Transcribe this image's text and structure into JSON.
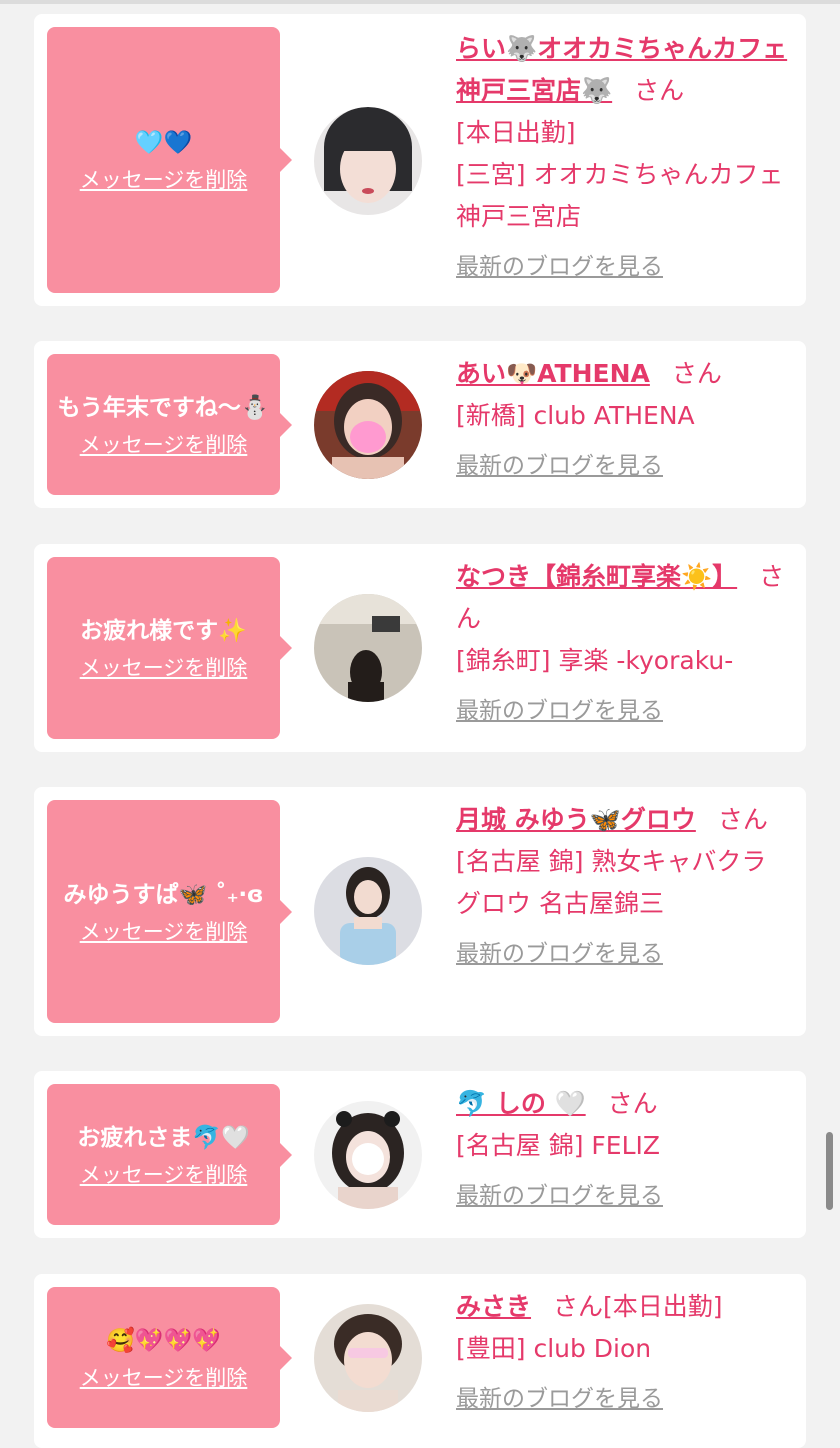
{
  "delete_label": "メッセージを削除",
  "blog_label": "最新のブログを見る",
  "san_label": "さん",
  "cards": [
    {
      "message": "🩵💙",
      "name": "らい🐺オオカミちゃんカフェ神戸三宮店🐺",
      "status": "[本日出勤]",
      "shop": "[三宮] オオカミちゃんカフェ神戸三宮店"
    },
    {
      "message": "もう年末ですね〜⛄",
      "name": "あい🐶ATHENA",
      "status": "",
      "shop": "[新橋] club ATHENA"
    },
    {
      "message": "お疲れ様です✨",
      "name": "なつき【錦糸町享楽☀️】",
      "status": "",
      "shop": "[錦糸町] 享楽 -kyoraku-"
    },
    {
      "message": "みゆうすぱ🦋 ˚₊‧ɞ",
      "name": "月城 みゆう🦋グロウ",
      "status": "",
      "shop": "[名古屋 錦] 熟女キャバクラグロウ 名古屋錦三"
    },
    {
      "message": "お疲れさま🐬🤍",
      "name": "🐬 しの 🤍",
      "status": "",
      "shop": "[名古屋 錦] FELIZ"
    },
    {
      "message": "🥰💖💖💖",
      "name": "みさき",
      "status": "[本日出勤]",
      "shop": "[豊田] club Dion"
    }
  ]
}
